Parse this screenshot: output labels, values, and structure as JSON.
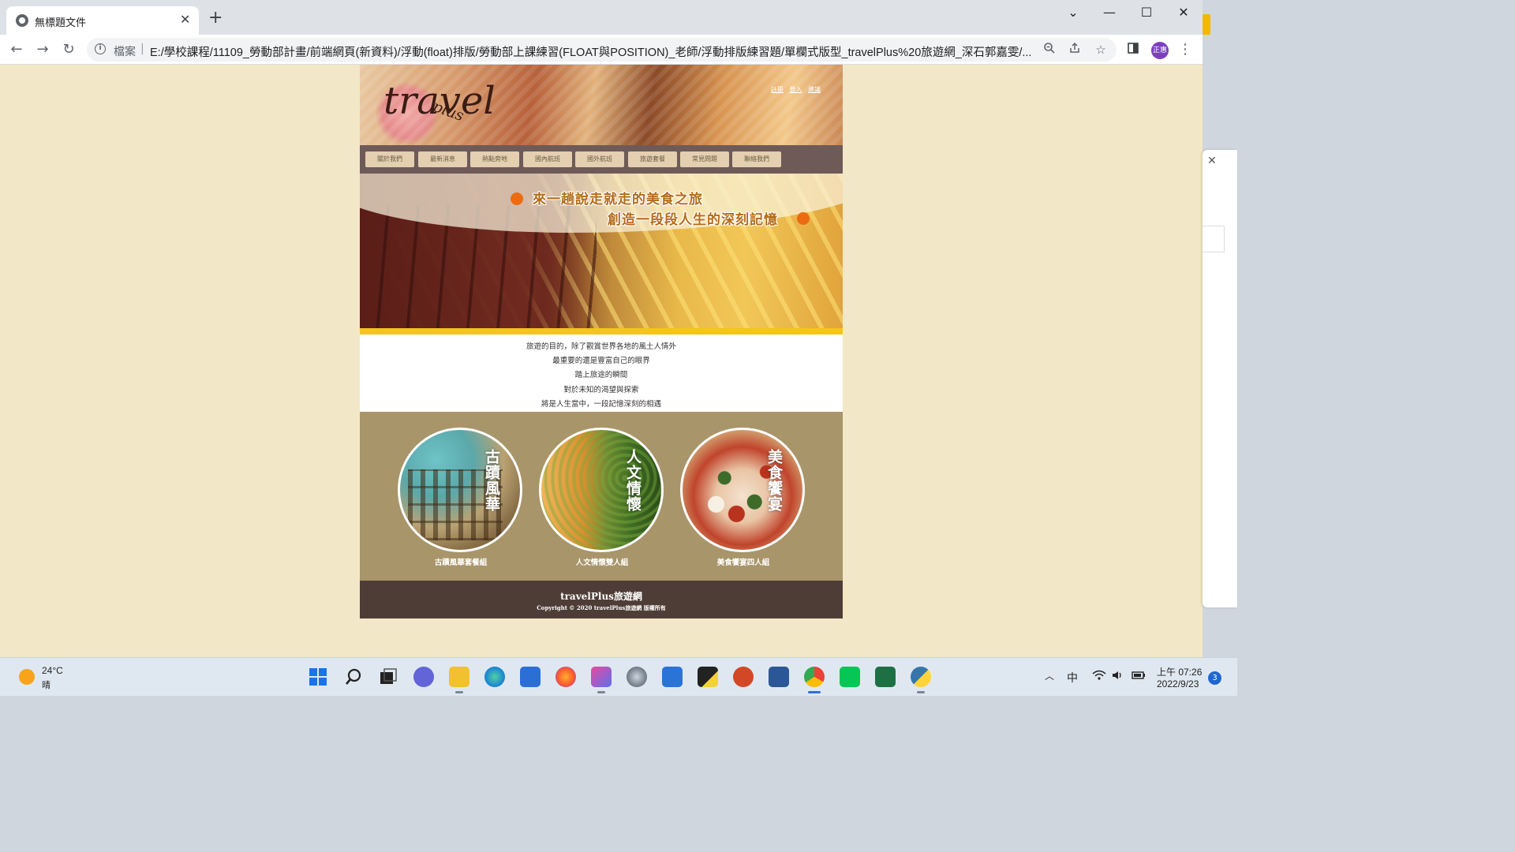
{
  "browser": {
    "tab_title": "無標題文件",
    "tab_close": "✕",
    "new_tab": "+",
    "window_controls": {
      "dropdown": "⌄",
      "minimize": "—",
      "maximize": "☐",
      "close": "✕"
    },
    "nav": {
      "back": "←",
      "forward": "→",
      "reload": "↻"
    },
    "url_scheme": "檔案",
    "url_separator": "|",
    "url": "E:/學校課程/11109_勞動部計畫/前端網頁(新資料)/浮動(float)排版/勞動部上課練習(FLOAT與POSITION)_老師/浮動排版練習題/單欄式版型_travelPlus%20旅遊網_深石郭嘉雯/...",
    "profile_label": "正惠",
    "omnibox_icons": [
      "zoom-icon",
      "share-icon",
      "star-icon"
    ],
    "toolbar_icons": [
      "side-panel-icon",
      "menu-icon"
    ]
  },
  "site": {
    "logo": "travel",
    "logo_sub": "plus",
    "top_links": [
      "註冊",
      "登入",
      "建議"
    ],
    "nav_items": [
      "關於我們",
      "最新消息",
      "熱點旁地",
      "國內航班",
      "國外航班",
      "旅遊套餐",
      "常見問題",
      "聯絡我們"
    ],
    "banner": {
      "line1": "來一趟說走就走的美食之旅",
      "line2": "創造一段段人生的深刻記憶",
      "accent": "#ec6b10"
    },
    "intro": [
      "旅遊的目的，除了觀賞世界各地的風土人情外",
      "最重要的還是豐富自己的眼界",
      "踏上旅途的瞬間",
      "對於未知的渴望與探索",
      "將是人生當中，一段記憶深刻的相遇"
    ],
    "cards": [
      {
        "title": "古蹟風華",
        "caption": "古蹟風華套餐組"
      },
      {
        "title": "人文情懷",
        "caption": "人文情懷雙人組"
      },
      {
        "title": "美食饗宴",
        "caption": "美食饗宴四人組"
      }
    ],
    "footer": {
      "title": "travelPlus旅遊網",
      "copyright": "Copyright © 2020 travelPlus旅遊網 版權所有"
    },
    "colors": {
      "page_bg": "#f2e7c6",
      "nav_bg": "#6e5b58",
      "cards_bg": "#a8956a",
      "footer_bg": "#4e3d36",
      "banner_stripe": "#f5c518"
    }
  },
  "side_window": {
    "close": "✕"
  },
  "taskbar": {
    "weather_temp": "24°C",
    "weather_cond": "晴",
    "apps": [
      "start-icon",
      "search-icon",
      "task-view-icon",
      "chat-icon",
      "file-explorer-icon",
      "edge-icon",
      "store-icon",
      "firefox-icon",
      "snipping-tool-icon",
      "settings-icon",
      "calendar-icon",
      "sticky-notes-icon",
      "powerpoint-icon",
      "word-icon",
      "chrome-icon",
      "line-icon",
      "excel-icon",
      "python-icon"
    ],
    "tray_chevron": "︿",
    "ime": "中",
    "time": "上午 07:26",
    "date": "2022/9/23",
    "notifications": "3"
  }
}
